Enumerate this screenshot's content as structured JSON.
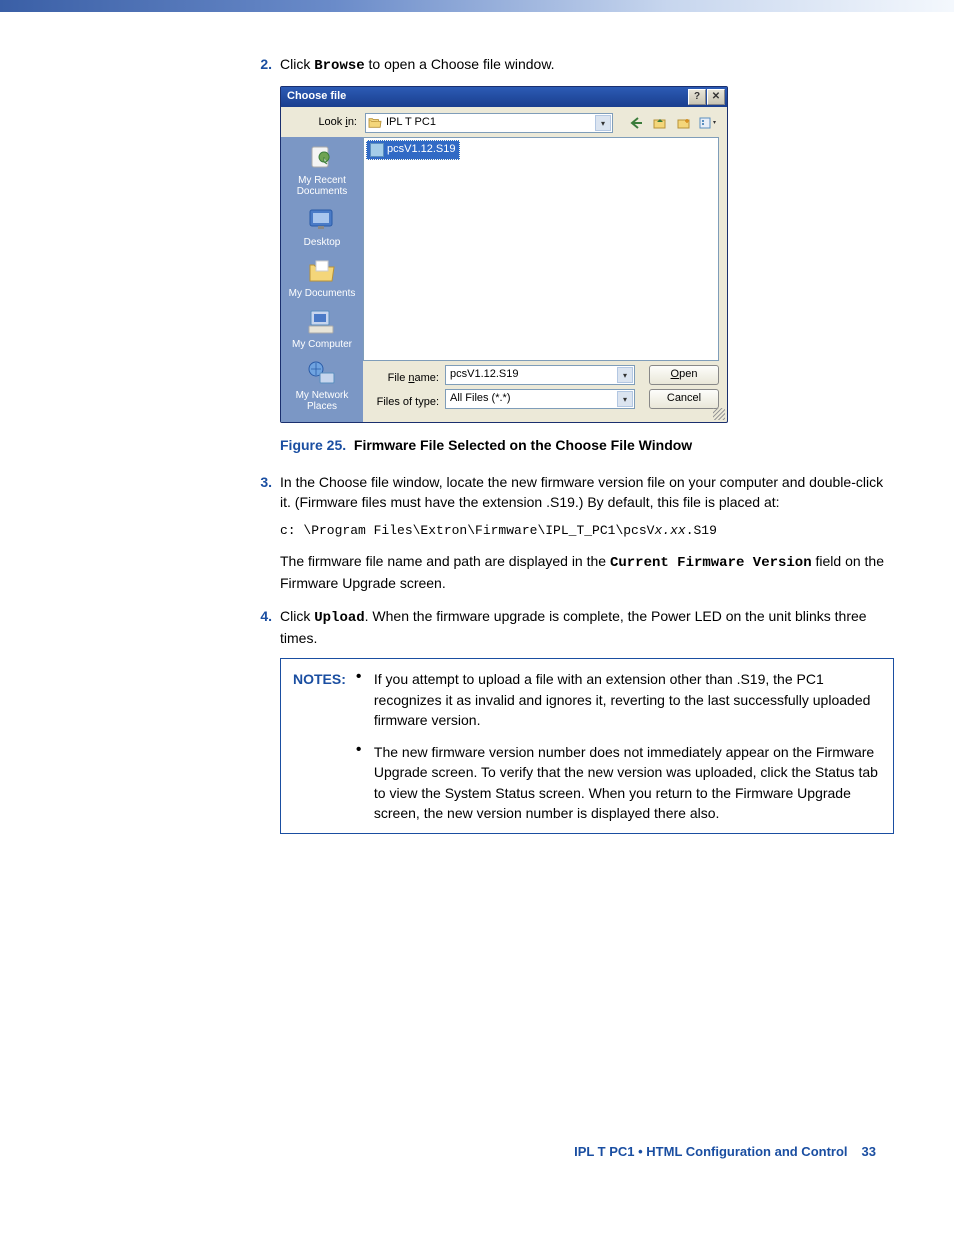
{
  "steps": {
    "s2": {
      "num": "2.",
      "pre": "Click ",
      "browse": "Browse",
      "post": " to open a Choose file window."
    },
    "s3": {
      "num": "3.",
      "text": "In the Choose file window, locate the new firmware version file on your computer and double-click it. (Firmware files must have the extension .S19.) By default, this file is placed at:"
    },
    "s3b_pre": "The firmware file name and path are displayed in the ",
    "s3b_mono": "Current Firmware Version",
    "s3b_post": " field on the Firmware Upgrade screen.",
    "s4": {
      "num": "4.",
      "pre": "Click ",
      "upload": "Upload",
      "post": ". When the firmware upgrade is complete, the Power LED on the unit blinks three times."
    }
  },
  "codepath": {
    "a": "c: \\Program Files\\Extron\\Firmware\\IPL_T_PC1\\pcsV",
    "b": "x.xx",
    "c": ".S19"
  },
  "figure": {
    "label": "Figure 25.",
    "caption": "Firmware File Selected on the Choose File Window"
  },
  "dialog": {
    "title": "Choose file",
    "help": "?",
    "close": "✕",
    "lookin_label": "Look in:",
    "lookin_value": "IPL T PC1",
    "places": [
      "My Recent Documents",
      "Desktop",
      "My Documents",
      "My Computer",
      "My Network Places"
    ],
    "file_item": "pcsV1.12.S19",
    "filename_label": "File name:",
    "filename_value": "pcsV1.12.S19",
    "filetype_label": "Files of type:",
    "filetype_value": "All Files (*.*)",
    "open_btn_u": "O",
    "open_btn_rest": "pen",
    "cancel_btn": "Cancel"
  },
  "notes": {
    "title": "NOTES:",
    "items": [
      "If you attempt to upload a file with an extension other than .S19, the PC1 recognizes it as invalid and ignores it, reverting to the last successfully uploaded firmware version.",
      "The new firmware version number does not immediately appear on the Firmware Upgrade screen. To verify that the new version was uploaded, click the Status tab to view the System Status screen. When you return to the Firmware Upgrade screen, the new version number is displayed there also."
    ]
  },
  "footer": {
    "text": "IPL T PC1 • HTML Configuration and Control",
    "page": "33"
  }
}
